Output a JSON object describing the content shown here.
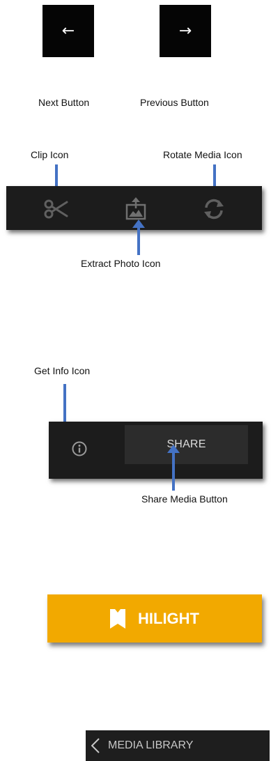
{
  "nav": {
    "next_symbol": "←",
    "previous_symbol": "→",
    "next_caption": "Next Button",
    "previous_caption": "Previous Button"
  },
  "toolbar": {
    "clip_caption": "Clip Icon",
    "rotate_caption": "Rotate Media Icon",
    "extract_caption": "Extract Photo Icon",
    "icons": [
      "scissors-icon",
      "extract-photo-icon",
      "rotate-icon"
    ]
  },
  "info_share": {
    "info_caption": "Get Info Icon",
    "share_label": "SHARE",
    "share_caption": "Share Media Button",
    "icons": [
      "info-icon"
    ]
  },
  "hilight": {
    "label": "HILIGHT",
    "icon": "hilight-tag-icon",
    "color": "#f2a900"
  },
  "media_library": {
    "label": "MEDIA LIBRARY",
    "icon": "chevron-left-icon"
  },
  "colors": {
    "arrow": "#4472c4",
    "panel": "#1c1c1c"
  }
}
